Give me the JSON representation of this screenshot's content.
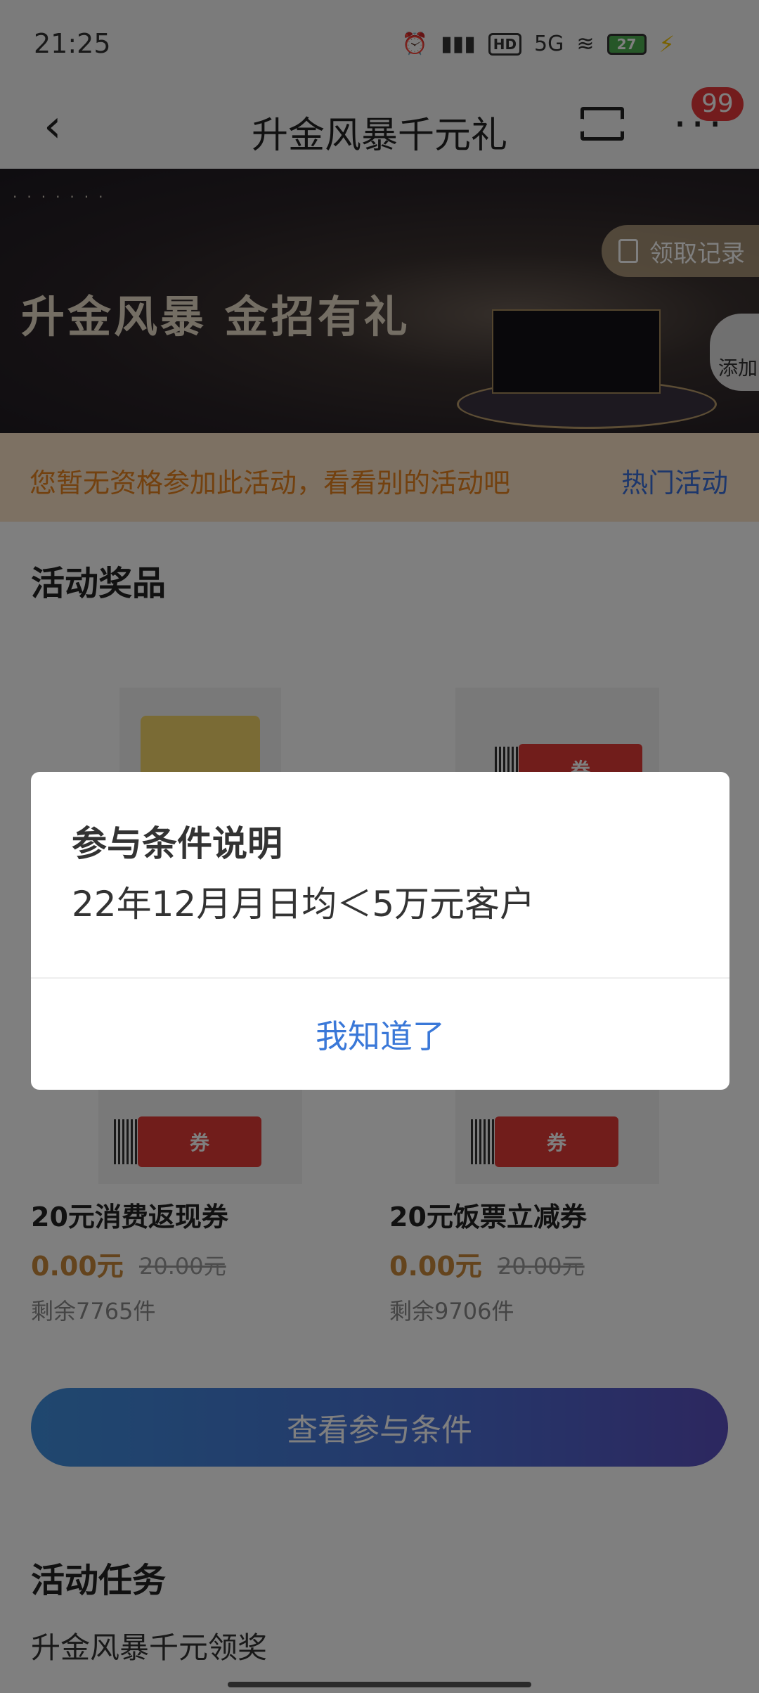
{
  "status": {
    "time": "21:25",
    "network": "5G",
    "battery": "27"
  },
  "header": {
    "title": "升金风暴千元礼",
    "badge": "99"
  },
  "banner": {
    "title": "升金风暴 金招有礼",
    "record_label": "领取记录",
    "add_label": "添加"
  },
  "notice": {
    "text": "您暂无资格参加此活动，看看别的活动吧",
    "link": "热门活动"
  },
  "prizes_section": {
    "title": "活动奖品"
  },
  "coupon_label": "券",
  "prizes": [
    {
      "name": "20元消费返现券",
      "price": "0.00元",
      "original_price": "20.00元",
      "stock": "剩余7765件"
    },
    {
      "name": "20元饭票立减券",
      "price": "0.00元",
      "original_price": "20.00元",
      "stock": "剩余9706件"
    }
  ],
  "cta": {
    "label": "查看参与条件"
  },
  "tasks_section": {
    "title": "活动任务",
    "subtitle": "升金风暴千元领奖"
  },
  "dialog": {
    "title": "参与条件说明",
    "body": "22年12月月日均＜5万元客户",
    "button": "我知道了"
  },
  "colors": {
    "accent_blue": "#3a78d8",
    "notice_orange": "#e6821e",
    "price_gold": "#c8893a",
    "badge_red": "#e7383a"
  }
}
